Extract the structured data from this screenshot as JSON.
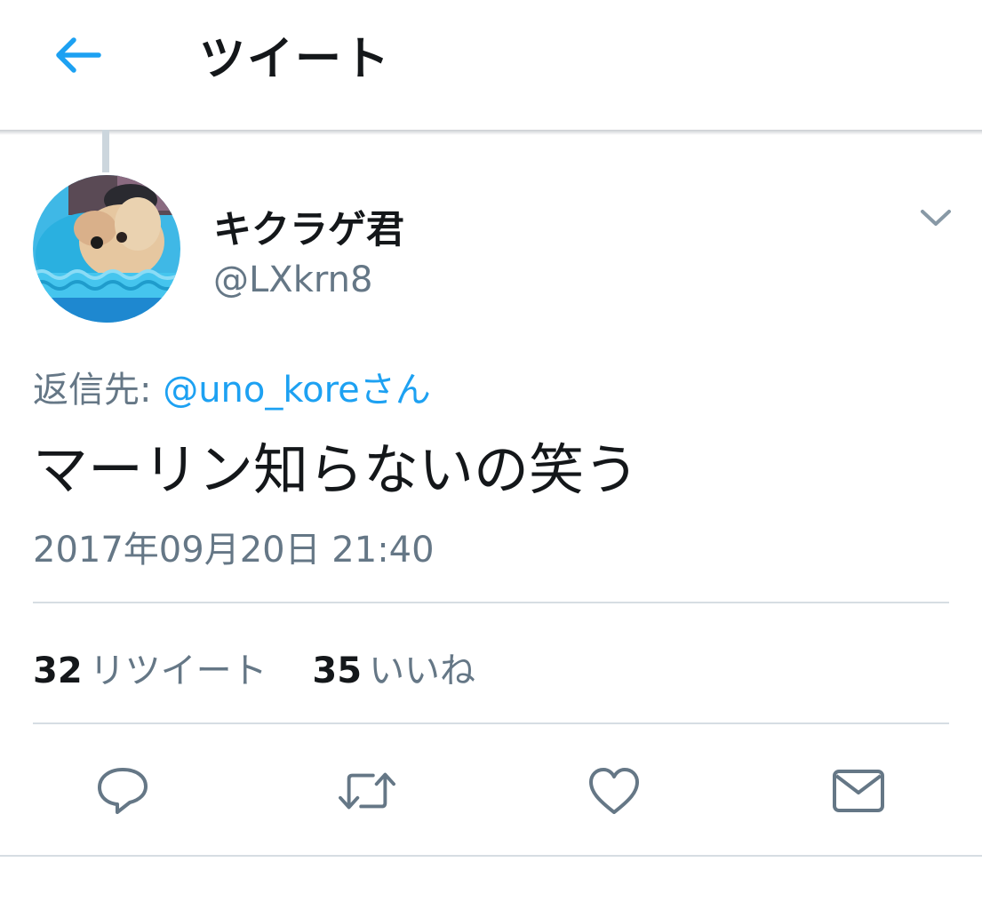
{
  "header": {
    "title": "ツイート",
    "back_icon": "back-arrow-icon",
    "accent_color": "#1da1f2"
  },
  "tweet": {
    "author": {
      "display_name": "キクラゲ君",
      "handle": "@LXkrn8",
      "avatar_icon": "dog-avatar"
    },
    "reply": {
      "prefix": "返信先: ",
      "mention": "@uno_koreさん"
    },
    "text": "マーリン知らないの笑う",
    "timestamp": "2017年09月20日 21:40",
    "stats": {
      "retweets": {
        "count": "32",
        "label": "リツイート"
      },
      "likes": {
        "count": "35",
        "label": "いいね"
      }
    },
    "actions": [
      {
        "name": "reply",
        "icon": "reply-icon"
      },
      {
        "name": "retweet",
        "icon": "retweet-icon"
      },
      {
        "name": "like",
        "icon": "heart-icon"
      },
      {
        "name": "share",
        "icon": "envelope-icon"
      }
    ],
    "menu_icon": "chevron-down-icon"
  },
  "colors": {
    "text_primary": "#14171a",
    "text_secondary": "#657786",
    "link": "#1da1f2",
    "divider": "#d6dde3"
  }
}
